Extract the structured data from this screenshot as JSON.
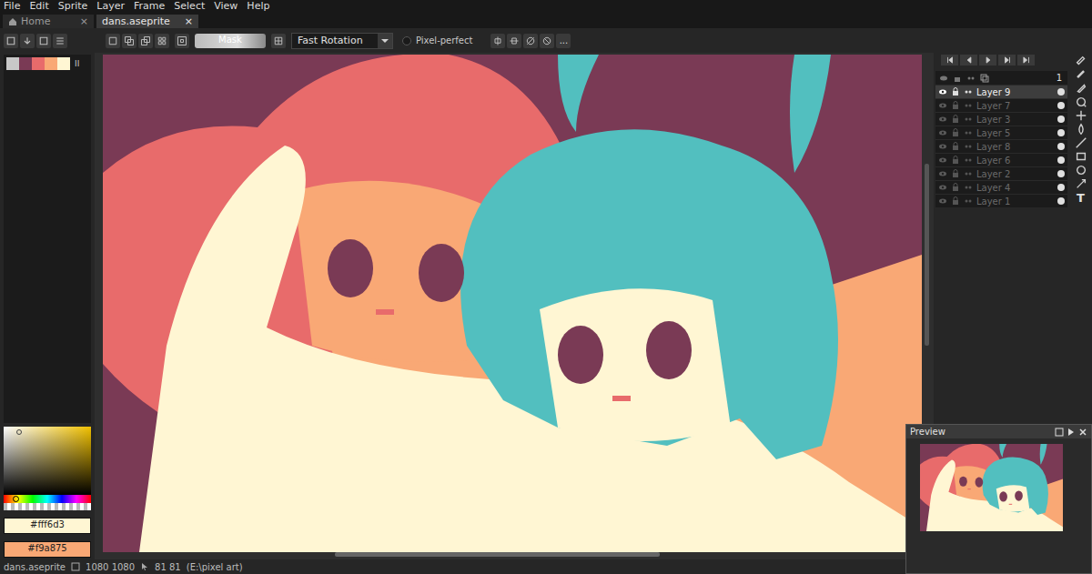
{
  "menu": [
    "File",
    "Edit",
    "Sprite",
    "Layer",
    "Frame",
    "Select",
    "View",
    "Help"
  ],
  "tabs": [
    {
      "label": "Home",
      "close": "×",
      "selected": false
    },
    {
      "label": "dans.aseprite",
      "close": "×",
      "selected": true
    }
  ],
  "toolbar": {
    "mask_button": "Mask",
    "rotation": "Fast Rotation",
    "pixel_perfect": {
      "label": "Pixel-perfect",
      "checked": false
    },
    "more_button": "..."
  },
  "palette": {
    "swatches": [
      {
        "color": "#c8c8c8"
      },
      {
        "color": "#7a3a55"
      },
      {
        "color": "#e86b6b"
      },
      {
        "color": "#f9a875"
      },
      {
        "color": "#fff6d3"
      }
    ],
    "handle": "II"
  },
  "colors": {
    "foreground": "#fff6d3",
    "background": "#f9a875",
    "hue_level": 0.1
  },
  "frames": {
    "current": "1"
  },
  "layers": [
    {
      "name": "Layer 9",
      "selected": true,
      "visible": true
    },
    {
      "name": "Layer 7",
      "selected": false,
      "visible": false
    },
    {
      "name": "Layer 3",
      "selected": false,
      "visible": false
    },
    {
      "name": "Layer 5",
      "selected": false,
      "visible": false
    },
    {
      "name": "Layer 8",
      "selected": false,
      "visible": false
    },
    {
      "name": "Layer 6",
      "selected": false,
      "visible": false
    },
    {
      "name": "Layer 2",
      "selected": false,
      "visible": false
    },
    {
      "name": "Layer 4",
      "selected": false,
      "visible": false
    },
    {
      "name": "Layer 1",
      "selected": false,
      "visible": false
    }
  ],
  "tools": {
    "text_tool": "T"
  },
  "preview": {
    "title": "Preview"
  },
  "status_bar": {
    "file": "dans.aseprite",
    "size": "1080 1080",
    "position": "81 81",
    "path": "(E:\\pixel art)"
  }
}
